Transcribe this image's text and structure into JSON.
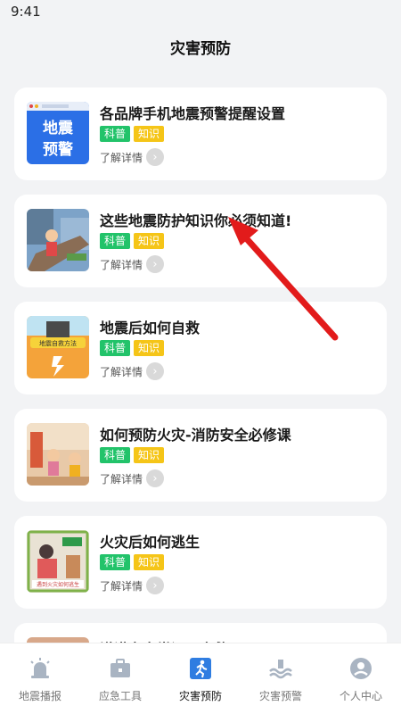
{
  "status_bar": {
    "time": "9:41"
  },
  "header": {
    "title": "灾害预防"
  },
  "detail_label": "了解详情",
  "articles": [
    {
      "title": "各品牌手机地震预警提醒设置",
      "tags": [
        "科普",
        "知识"
      ],
      "thumb_text": [
        "地震",
        "预警"
      ]
    },
    {
      "title": "这些地震防护知识你必须知道!",
      "tags": [
        "科普",
        "知识"
      ]
    },
    {
      "title": "地震后如何自救",
      "tags": [
        "科普",
        "知识"
      ],
      "thumb_text": [
        "地震自救方法"
      ]
    },
    {
      "title": "如何预防火灾-消防安全必修课",
      "tags": [
        "科普",
        "知识"
      ]
    },
    {
      "title": "火灾后如何逃生",
      "tags": [
        "科普",
        "知识"
      ],
      "thumb_text": [
        "遇到火灾如何逃生"
      ]
    },
    {
      "title": "洪涝灾害常识及自救"
    }
  ],
  "tabs": [
    {
      "label": "地震播报",
      "icon": "alarm-icon"
    },
    {
      "label": "应急工具",
      "icon": "toolbox-icon"
    },
    {
      "label": "灾害预防",
      "icon": "running-person-icon",
      "active": true
    },
    {
      "label": "灾害预警",
      "icon": "warning-wave-icon"
    },
    {
      "label": "个人中心",
      "icon": "user-icon"
    }
  ],
  "colors": {
    "background": "#f2f3f5",
    "tag_green": "#22c36a",
    "tag_yellow": "#f5c518",
    "active_tab": "#2f7de1",
    "inactive_tab": "#a9b4c2",
    "arrow": "#e21b1b"
  }
}
